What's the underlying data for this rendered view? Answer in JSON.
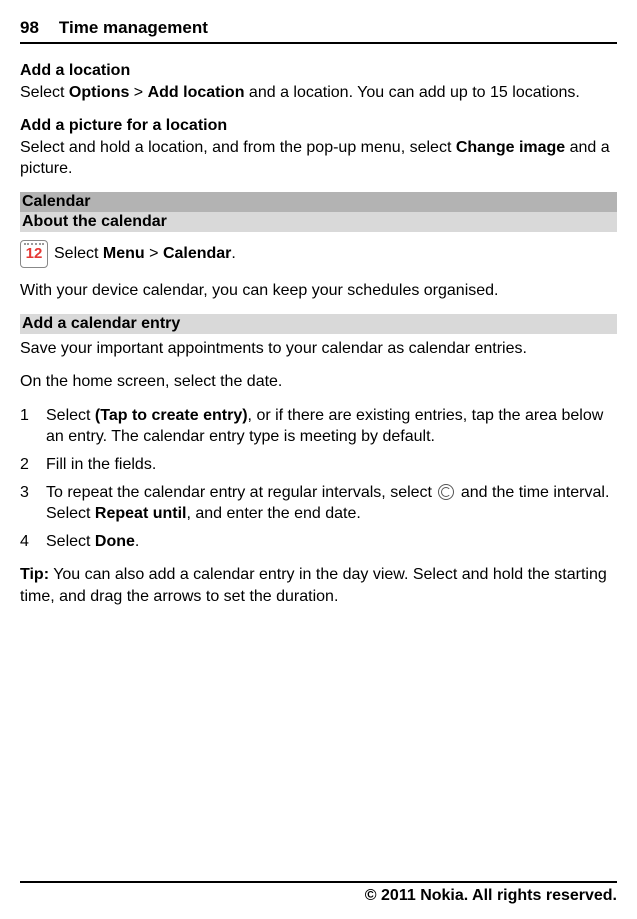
{
  "header": {
    "page_number": "98",
    "section": "Time management"
  },
  "addLocation": {
    "heading": "Add a location",
    "text_prefix": "Select ",
    "options_bold": "Options",
    "gt": " > ",
    "addloc_bold": "Add location",
    "text_suffix": " and a location. You can add up to 15 locations."
  },
  "addPicture": {
    "heading": "Add a picture for a location",
    "text_prefix": "Select and hold a location, and from the pop-up menu, select ",
    "change_bold": "Change image",
    "text_suffix": " and a picture."
  },
  "calendarHeading": "Calendar",
  "aboutCalendar": {
    "heading": "About the calendar",
    "icon_text": "12",
    "select_prefix": "Select ",
    "menu_bold": "Menu",
    "gt": " > ",
    "cal_bold": "Calendar",
    "period": ".",
    "body": "With your device calendar, you can keep your schedules organised."
  },
  "addEntry": {
    "heading": "Add a calendar entry",
    "intro": "Save your important appointments to your calendar as calendar entries.",
    "home": "On the home screen, select the date.",
    "steps": [
      {
        "num": "1",
        "prefix": "Select ",
        "bold1": "(Tap to create entry)",
        "suffix": ", or if there are existing entries, tap the area below an entry. The calendar entry type is meeting by default."
      },
      {
        "num": "2",
        "text": "Fill in the fields."
      },
      {
        "num": "3",
        "prefix": "To repeat the calendar entry at regular intervals, select ",
        "mid": " and the time interval. Select ",
        "bold1": "Repeat until",
        "suffix": ", and enter the end date."
      },
      {
        "num": "4",
        "prefix": "Select ",
        "bold1": "Done",
        "suffix": "."
      }
    ],
    "tip_label": "Tip:",
    "tip_text": " You can also add a calendar entry in the day view. Select and hold the starting time, and drag the arrows to set the duration."
  },
  "footer": "© 2011 Nokia. All rights reserved."
}
